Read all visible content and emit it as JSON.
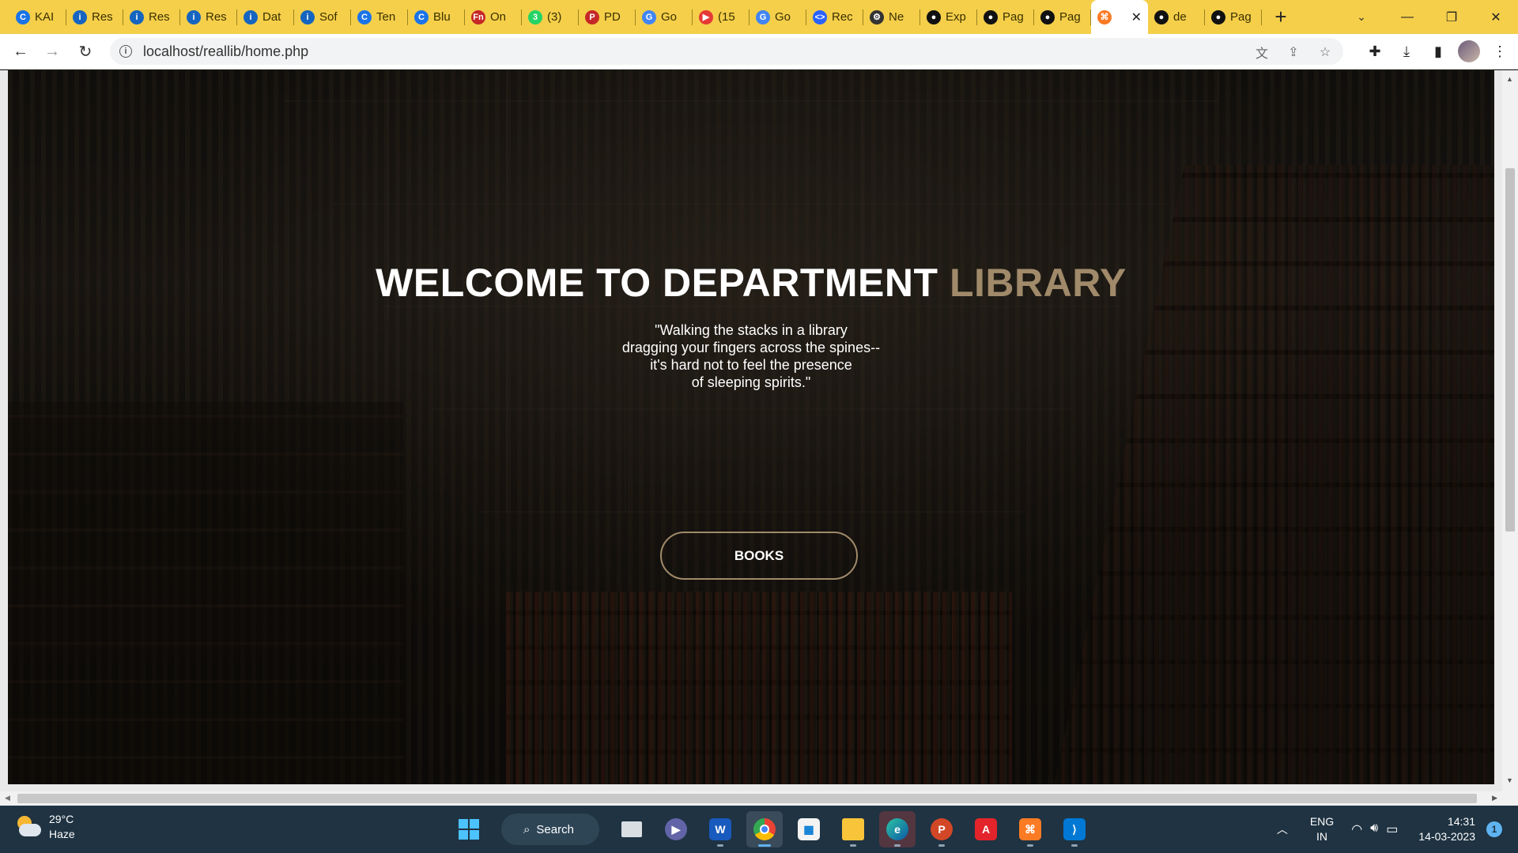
{
  "browser": {
    "tabs": [
      {
        "title": "KAI",
        "icon": "c-logo-icon",
        "color": "#1a73e8",
        "glyph": "C"
      },
      {
        "title": "Res",
        "icon": "info-i-icon",
        "color": "#1565c0",
        "glyph": "i"
      },
      {
        "title": "Res",
        "icon": "info-i-icon",
        "color": "#1565c0",
        "glyph": "i"
      },
      {
        "title": "Res",
        "icon": "info-i-icon",
        "color": "#1565c0",
        "glyph": "i"
      },
      {
        "title": "Dat",
        "icon": "info-i-icon",
        "color": "#1565c0",
        "glyph": "i"
      },
      {
        "title": "Sof",
        "icon": "info-i-icon",
        "color": "#1565c0",
        "glyph": "i"
      },
      {
        "title": "Ten",
        "icon": "c-logo-icon",
        "color": "#1a73e8",
        "glyph": "C"
      },
      {
        "title": "Blu",
        "icon": "c-logo-icon",
        "color": "#1a73e8",
        "glyph": "C"
      },
      {
        "title": "On",
        "icon": "fn-logo-icon",
        "color": "#c62828",
        "glyph": "Fn"
      },
      {
        "title": "(3)",
        "icon": "whatsapp-icon",
        "color": "#25d366",
        "glyph": "3"
      },
      {
        "title": "PD",
        "icon": "pdf-icon",
        "color": "#c62828",
        "glyph": "P"
      },
      {
        "title": "Go",
        "icon": "google-icon",
        "color": "#4285f4",
        "glyph": "G"
      },
      {
        "title": "(15",
        "icon": "youtube-icon",
        "color": "#e53935",
        "glyph": "▶"
      },
      {
        "title": "Go",
        "icon": "google-icon",
        "color": "#4285f4",
        "glyph": "G"
      },
      {
        "title": "Rec",
        "icon": "code-icon",
        "color": "#2962ff",
        "glyph": "<>"
      },
      {
        "title": "Ne",
        "icon": "openai-icon",
        "color": "#333333",
        "glyph": "⚙"
      },
      {
        "title": "Exp",
        "icon": "github-icon",
        "color": "#111111",
        "glyph": "●"
      },
      {
        "title": "Pag",
        "icon": "github-icon",
        "color": "#111111",
        "glyph": "●"
      },
      {
        "title": "Pag",
        "icon": "github-icon",
        "color": "#111111",
        "glyph": "●"
      },
      {
        "title": "",
        "icon": "xampp-icon",
        "color": "#fb7a24",
        "glyph": "⌘",
        "active": true
      },
      {
        "title": "de",
        "icon": "github-icon",
        "color": "#111111",
        "glyph": "●"
      },
      {
        "title": "Pag",
        "icon": "github-icon",
        "color": "#111111",
        "glyph": "●"
      }
    ],
    "url": "localhost/reallib/home.php"
  },
  "page": {
    "title_main": "WELCOME TO DEPARTMENT ",
    "title_accent": "LIBRARY",
    "quote_lines": [
      "\"Walking the stacks in a library",
      "dragging your fingers across the spines--",
      "it's hard not to feel the presence",
      "of sleeping spirits.\""
    ],
    "button_label": "BOOKS",
    "accent_color": "#a08a6a"
  },
  "taskbar": {
    "weather_temp": "29°C",
    "weather_desc": "Haze",
    "search_label": "Search",
    "lang_top": "ENG",
    "lang_bottom": "IN",
    "time": "14:31",
    "date": "14-03-2023",
    "notification_count": "1"
  }
}
